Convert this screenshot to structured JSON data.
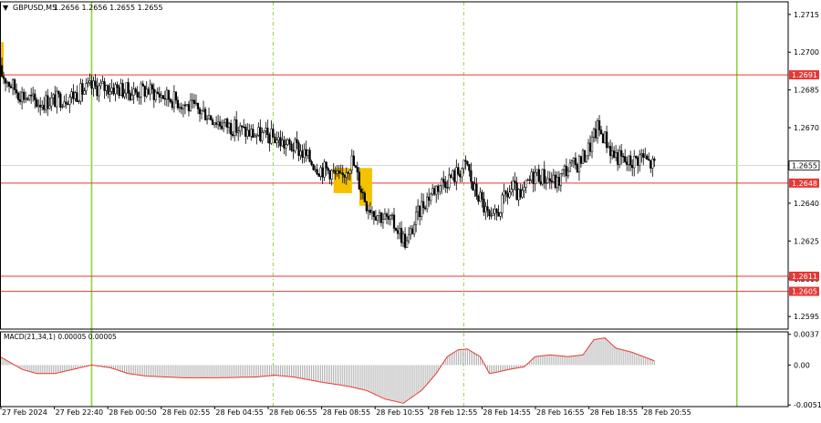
{
  "header": {
    "arrow": "▼",
    "symbol": "GBPUSD,M5",
    "ohlc": "1.2656 1.2656 1.2655 1.2655"
  },
  "macd_label": "MACD(21,34,1) 0.00005 0.00005",
  "chart_data": [
    {
      "type": "candlestick",
      "symbol": "GBPUSD",
      "timeframe": "M5",
      "last_price": 1.2655,
      "ylim": [
        1.259,
        1.272
      ],
      "yticks": [
        "1.2715",
        "1.2700",
        "1.2685",
        "1.2670",
        "1.2655",
        "1.2640",
        "1.2625",
        "1.2610",
        "1.2595"
      ],
      "xticks": [
        "27 Feb 2024",
        "27 Feb 22:40",
        "28 Feb 00:50",
        "28 Feb 02:55",
        "28 Feb 04:55",
        "28 Feb 06:55",
        "28 Feb 08:55",
        "28 Feb 10:55",
        "28 Feb 12:55",
        "28 Feb 14:55",
        "28 Feb 16:55",
        "28 Feb 18:55",
        "28 Feb 20:55"
      ],
      "levels": [
        {
          "value": 1.2691,
          "label": "1.2691",
          "color": "#e53935"
        },
        {
          "value": 1.2648,
          "label": "1.2648",
          "color": "#e53935"
        },
        {
          "value": 1.2611,
          "label": "1.2611",
          "color": "#e53935"
        },
        {
          "value": 1.2605,
          "label": "1.2605",
          "color": "#e53935"
        }
      ],
      "price_label": {
        "value": 1.2655,
        "label": "1.2655"
      },
      "colors": {
        "up": "#ffffff",
        "down": "#000000",
        "wick": "#000000",
        "level": "#e53935",
        "session": "#8bd33b",
        "highlight": "#f5c200"
      },
      "path": [
        [
          0,
          1.2692
        ],
        [
          10,
          1.2684
        ],
        [
          20,
          1.268
        ],
        [
          30,
          1.2681
        ],
        [
          40,
          1.2683
        ],
        [
          50,
          1.2686
        ],
        [
          62,
          1.2686
        ],
        [
          72,
          1.2684
        ],
        [
          80,
          1.2685
        ],
        [
          88,
          1.2683
        ],
        [
          96,
          1.2681
        ],
        [
          104,
          1.2678
        ],
        [
          112,
          1.2676
        ],
        [
          120,
          1.2672
        ],
        [
          128,
          1.267
        ],
        [
          135,
          1.2668
        ],
        [
          142,
          1.2667
        ],
        [
          150,
          1.2666
        ],
        [
          156,
          1.2663
        ],
        [
          162,
          1.2662
        ],
        [
          168,
          1.2658
        ],
        [
          174,
          1.2654
        ],
        [
          180,
          1.2653
        ],
        [
          186,
          1.2649
        ],
        [
          189,
          1.2654
        ],
        [
          192,
          1.2657
        ],
        [
          194,
          1.2653
        ],
        [
          196,
          1.2648
        ],
        [
          200,
          1.264
        ],
        [
          204,
          1.2637
        ],
        [
          210,
          1.2634
        ],
        [
          216,
          1.2631
        ],
        [
          220,
          1.2626
        ],
        [
          222,
          1.2624
        ],
        [
          226,
          1.2632
        ],
        [
          230,
          1.2639
        ],
        [
          236,
          1.2645
        ],
        [
          242,
          1.2649
        ],
        [
          248,
          1.2651
        ],
        [
          252,
          1.2654
        ],
        [
          255,
          1.2655
        ],
        [
          258,
          1.2646
        ],
        [
          262,
          1.2642
        ],
        [
          266,
          1.2635
        ],
        [
          268,
          1.2632
        ],
        [
          272,
          1.2637
        ],
        [
          276,
          1.2643
        ],
        [
          280,
          1.2646
        ],
        [
          284,
          1.2641
        ],
        [
          288,
          1.2648
        ],
        [
          292,
          1.2652
        ],
        [
          298,
          1.265
        ],
        [
          304,
          1.2648
        ],
        [
          308,
          1.2653
        ],
        [
          314,
          1.2655
        ],
        [
          318,
          1.2658
        ],
        [
          322,
          1.2663
        ],
        [
          326,
          1.267
        ],
        [
          330,
          1.2666
        ],
        [
          334,
          1.266
        ],
        [
          338,
          1.2658
        ],
        [
          342,
          1.2656
        ],
        [
          346,
          1.2657
        ],
        [
          350,
          1.2659
        ],
        [
          354,
          1.2656
        ],
        [
          357,
          1.2655
        ]
      ],
      "highlights": [
        {
          "from": 182,
          "to": 192,
          "high": 1.2654,
          "low": 1.2644
        },
        {
          "from": 196,
          "to": 203,
          "high": 1.2654,
          "low": 1.2639
        }
      ],
      "sessions": [
        {
          "t": 50,
          "style": "solid"
        },
        {
          "t": 149,
          "style": "dashed"
        },
        {
          "t": 253,
          "style": "dashed"
        },
        {
          "t": 402,
          "style": "solid"
        }
      ],
      "t_max": 430,
      "candle_count": 358
    },
    {
      "type": "histogram",
      "name": "MACD(21,34,1)",
      "values_label": "0.00005 0.00005",
      "ylim": [
        -0.0005,
        0.0004
      ],
      "yticks": [
        "0.0037",
        "0.00",
        "-0.0051"
      ],
      "signal_color": "#e53935",
      "bar_color": "#9e9e9e",
      "path": [
        [
          0,
          0.0001
        ],
        [
          12,
          -5e-05
        ],
        [
          20,
          -0.0001
        ],
        [
          30,
          -0.0001
        ],
        [
          40,
          -5e-05
        ],
        [
          50,
          0.0
        ],
        [
          60,
          -3e-05
        ],
        [
          70,
          -0.0001
        ],
        [
          80,
          -0.00013
        ],
        [
          100,
          -0.00015
        ],
        [
          120,
          -0.00015
        ],
        [
          140,
          -0.00014
        ],
        [
          150,
          -0.00012
        ],
        [
          160,
          -0.00014
        ],
        [
          175,
          -0.0002
        ],
        [
          190,
          -0.00025
        ],
        [
          200,
          -0.0003
        ],
        [
          210,
          -0.0004
        ],
        [
          220,
          -0.00045
        ],
        [
          230,
          -0.0003
        ],
        [
          238,
          -0.0001
        ],
        [
          244,
          0.0001
        ],
        [
          250,
          0.00018
        ],
        [
          255,
          0.00019
        ],
        [
          262,
          0.0001
        ],
        [
          267,
          -0.0001
        ],
        [
          272,
          -8e-05
        ],
        [
          278,
          -5e-05
        ],
        [
          286,
          -2e-05
        ],
        [
          292,
          0.0001
        ],
        [
          300,
          0.00012
        ],
        [
          310,
          0.0001
        ],
        [
          318,
          0.00012
        ],
        [
          324,
          0.0003
        ],
        [
          330,
          0.00032
        ],
        [
          336,
          0.0002
        ],
        [
          345,
          0.00015
        ],
        [
          357,
          5e-05
        ]
      ]
    }
  ]
}
